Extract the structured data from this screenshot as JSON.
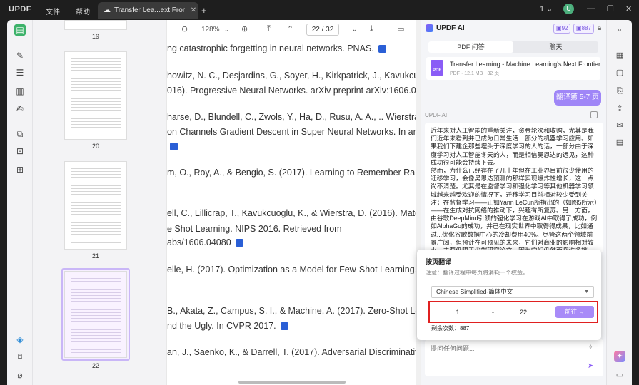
{
  "titlebar": {
    "brand": "UPDF",
    "menus": [
      "文件",
      "帮助"
    ],
    "tab_title": "Transfer Lea...ext Frontier",
    "page_indicator": "1",
    "avatar": "U"
  },
  "doc_toolbar": {
    "zoom": "128%",
    "page_current": "22",
    "page_sep": "/",
    "page_total": "32"
  },
  "thumbnails": [
    {
      "page": "19"
    },
    {
      "page": "20"
    },
    {
      "page": "21"
    },
    {
      "page": "22"
    }
  ],
  "doc_lines": [
    "ng catastrophic forgetting in neural networks. PNAS.",
    "howitz, N. C., Desjardins, G., Soyer, H., Kirkpatrick, J., Kavukcuoglu, K.",
    "016). Progressive Neural Networks. arXiv preprint arXiv:1606.04671.",
    "harse, D., Blundell, C., Zwols, Y., Ha, D., Rusu, A. A., .. Wierstra, D. (20",
    "on Channels Gradient Descent in Super Neural Networks. In arXiv pre",
    "m, O., Roy, A., & Bengio, S. (2017). Learning to Remember Rare Event",
    "ell, C., Lillicrap, T., Kavukcuoglu, K., & Wierstra, D. (2016). Matching",
    "e Shot Learning. NIPS 2016. Retrieved from",
    "abs/1606.04080",
    "elle, H. (2017). Optimization as a Model for Few-Shot Learning. In IC",
    "B., Akata, Z., Campus, S. I., & Machine, A. (2017). Zero-Shot Learning",
    "nd the Ugly. In CVPR 2017.",
    "an, J., Saenko, K., & Darrell, T. (2017). Adversarial Discriminative Doma"
  ],
  "ai": {
    "title": "UPDF AI",
    "credit1": "92",
    "credit2": "887",
    "tabs": [
      "PDF 问答",
      "聊天"
    ],
    "file_name": "Transfer Learning - Machine Learning's Next Frontier",
    "file_meta": "PDF · 12.1 MB · 32 页",
    "pdf_badge": "PDF",
    "user_msg": "翻译第 5-7 页",
    "ai_label": "UPDF AI",
    "answer": "近年来对人工智能的重新关注，资金轮次和收购，尤其是我们近年来看到并已成为日常生活一部分的机器学习应用。如果我们下建企那些埋头于深度学习的人的话，一部分由于深度学习对人工智能冬天的人，而是相信吴恩达的远见，这种成功很可能会持续下去。\n然而，为什么已经存在了几十年但在工业界目前很少使用的迁移学习，会像吴恩达预测的那样实现爆炸性增长，这一点尚不清楚。尤其是在监督学习和强化学习等其他机器学习领域越来越受欢迎的情况下，迁移学习目前相对较少受到关注；在监督学习——正如Yann LeCun所指出的（如图5所示）——在生成对抗网络的推动下，兴趣有所复苏。另一方面，由谷歌DeepMind引领的强化学习在游戏AI中取得了成功，例如AlphaGo的成功，并已在现实世界中取得得成果，比如通过...优化谷歌数据中心的冷却费用40%。尽管这两个领域前景广阔，但预计在可预见的未来，它们对商业的影响相对较小，主要仍限于尖端研究论文，因为它们仍然面临许多挑战。\n图5：Yann LeCun的蛋糕配方中明显缺少迁移学习"
  },
  "popup": {
    "title": "按页翻译",
    "note": "注意：翻译过程中每页将消耗一个权益。",
    "language": "Chinese Simplified-简体中文",
    "from": "1",
    "dash": "-",
    "to": "22",
    "go_label": "前往 →",
    "remaining_label": "剩余次数：",
    "remaining": "887"
  },
  "ask": {
    "placeholder": "提问任何问题..."
  }
}
